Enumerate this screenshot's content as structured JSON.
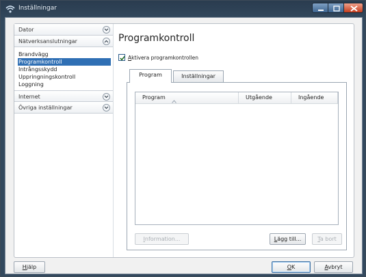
{
  "window": {
    "title": "Inställningar"
  },
  "nav": {
    "sections": [
      {
        "label": "Dator"
      },
      {
        "label": "Nätverksanslutningar"
      },
      {
        "label": "Internet"
      },
      {
        "label": "Övriga inställningar"
      }
    ],
    "items": [
      {
        "label": "Brandvägg"
      },
      {
        "label": "Programkontroll"
      },
      {
        "label": "Intrångsskydd"
      },
      {
        "label": "Uppringningskontroll"
      },
      {
        "label": "Loggning"
      }
    ]
  },
  "main": {
    "heading": "Programkontroll",
    "enable_checkbox": {
      "prefix": "A",
      "rest": "ktivera programkontrollen",
      "checked": true
    },
    "tabs": [
      {
        "label": "Program"
      },
      {
        "label": "Inställningar"
      }
    ],
    "list": {
      "columns": [
        {
          "label": "Program"
        },
        {
          "label": "Utgående"
        },
        {
          "label": "Ingående"
        }
      ]
    },
    "buttons": {
      "information": {
        "prefix": "I",
        "rest": "nformation..."
      },
      "add": {
        "prefix": "L",
        "rest": "ägg till..."
      },
      "remove": {
        "prefix": "T",
        "rest": "a bort"
      }
    }
  },
  "footer": {
    "help": {
      "prefix": "H",
      "rest": "jälp"
    },
    "ok": {
      "prefix": "O",
      "rest": "K"
    },
    "cancel": {
      "prefix": "A",
      "rest": "vbryt"
    }
  },
  "colors": {
    "accent": "#2f6fb4",
    "titlebar": "#2a3c4f",
    "close": "#c43b1c"
  }
}
